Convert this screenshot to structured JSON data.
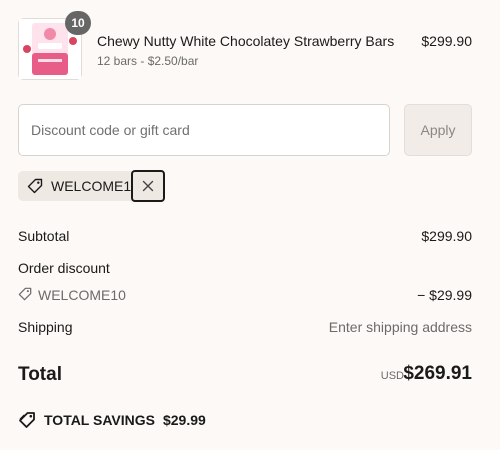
{
  "product": {
    "quantity_badge": "10",
    "name": "Chewy Nutty White Chocolatey Strawberry Bars",
    "meta": "12 bars - $2.50/bar",
    "price": "$299.90",
    "image_icon": "product-box-image"
  },
  "discount": {
    "placeholder": "Discount code or gift card",
    "value": "",
    "apply_label": "Apply"
  },
  "applied_code": {
    "code": "WELCOME10",
    "tag_icon": "tag-icon",
    "remove_icon": "close-icon"
  },
  "summary": {
    "subtotal_label": "Subtotal",
    "subtotal_value": "$299.90",
    "order_discount_label": "Order discount",
    "discount_code": "WELCOME10",
    "discount_value": "− $29.99",
    "shipping_label": "Shipping",
    "shipping_value": "Enter shipping address"
  },
  "total": {
    "label": "Total",
    "currency": "USD",
    "amount": "$269.91"
  },
  "savings": {
    "label": "TOTAL SAVINGS",
    "amount": "$29.99"
  },
  "colors": {
    "background": "#fcf9f6",
    "chip_background": "#efe9e4",
    "badge": "#666666",
    "product_pink": "#e85d88"
  }
}
